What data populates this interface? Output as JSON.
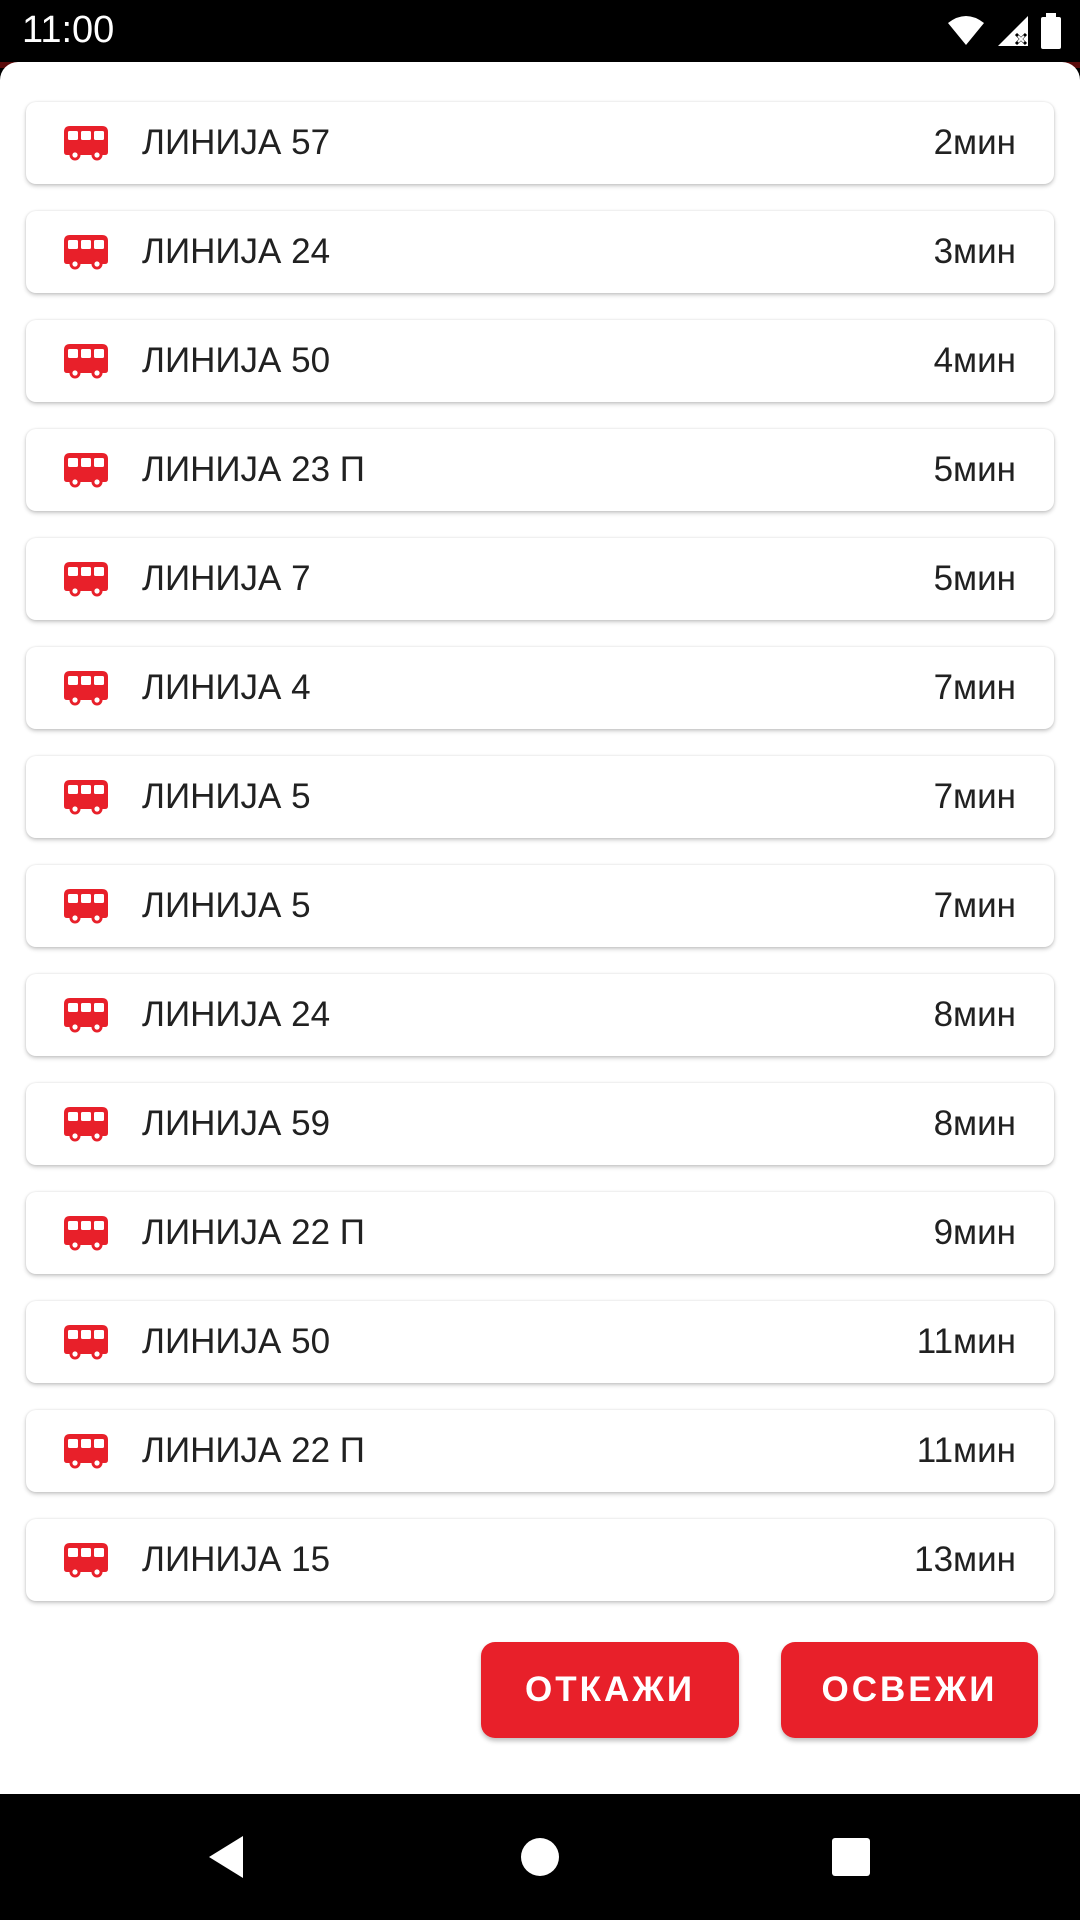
{
  "status_bar": {
    "time": "11:00",
    "icons": [
      "wifi-icon",
      "signal-icon",
      "battery-icon"
    ]
  },
  "colors": {
    "accent": "#e8202a",
    "text": "#212121",
    "dialog_bg": "#ffffff",
    "system_bar": "#000000"
  },
  "arrivals": [
    {
      "line": "ЛИНИЈА 57",
      "eta": "2мин"
    },
    {
      "line": "ЛИНИЈА 24",
      "eta": "3мин"
    },
    {
      "line": "ЛИНИЈА 50",
      "eta": "4мин"
    },
    {
      "line": "ЛИНИЈА 23 П",
      "eta": "5мин"
    },
    {
      "line": "ЛИНИЈА 7",
      "eta": "5мин"
    },
    {
      "line": "ЛИНИЈА 4",
      "eta": "7мин"
    },
    {
      "line": "ЛИНИЈА 5",
      "eta": "7мин"
    },
    {
      "line": "ЛИНИЈА 5",
      "eta": "7мин"
    },
    {
      "line": "ЛИНИЈА 24",
      "eta": "8мин"
    },
    {
      "line": "ЛИНИЈА 59",
      "eta": "8мин"
    },
    {
      "line": "ЛИНИЈА 22 П",
      "eta": "9мин"
    },
    {
      "line": "ЛИНИЈА 50",
      "eta": "11мин"
    },
    {
      "line": "ЛИНИЈА 22 П",
      "eta": "11мин"
    },
    {
      "line": "ЛИНИЈА 15",
      "eta": "13мин"
    }
  ],
  "row_icon": "bus-icon",
  "buttons": {
    "cancel_label": "ОТКАЖИ",
    "refresh_label": "ОСВЕЖИ"
  },
  "nav": {
    "back_icon": "back-triangle-icon",
    "home_icon": "home-circle-icon",
    "recents_icon": "recents-square-icon"
  }
}
